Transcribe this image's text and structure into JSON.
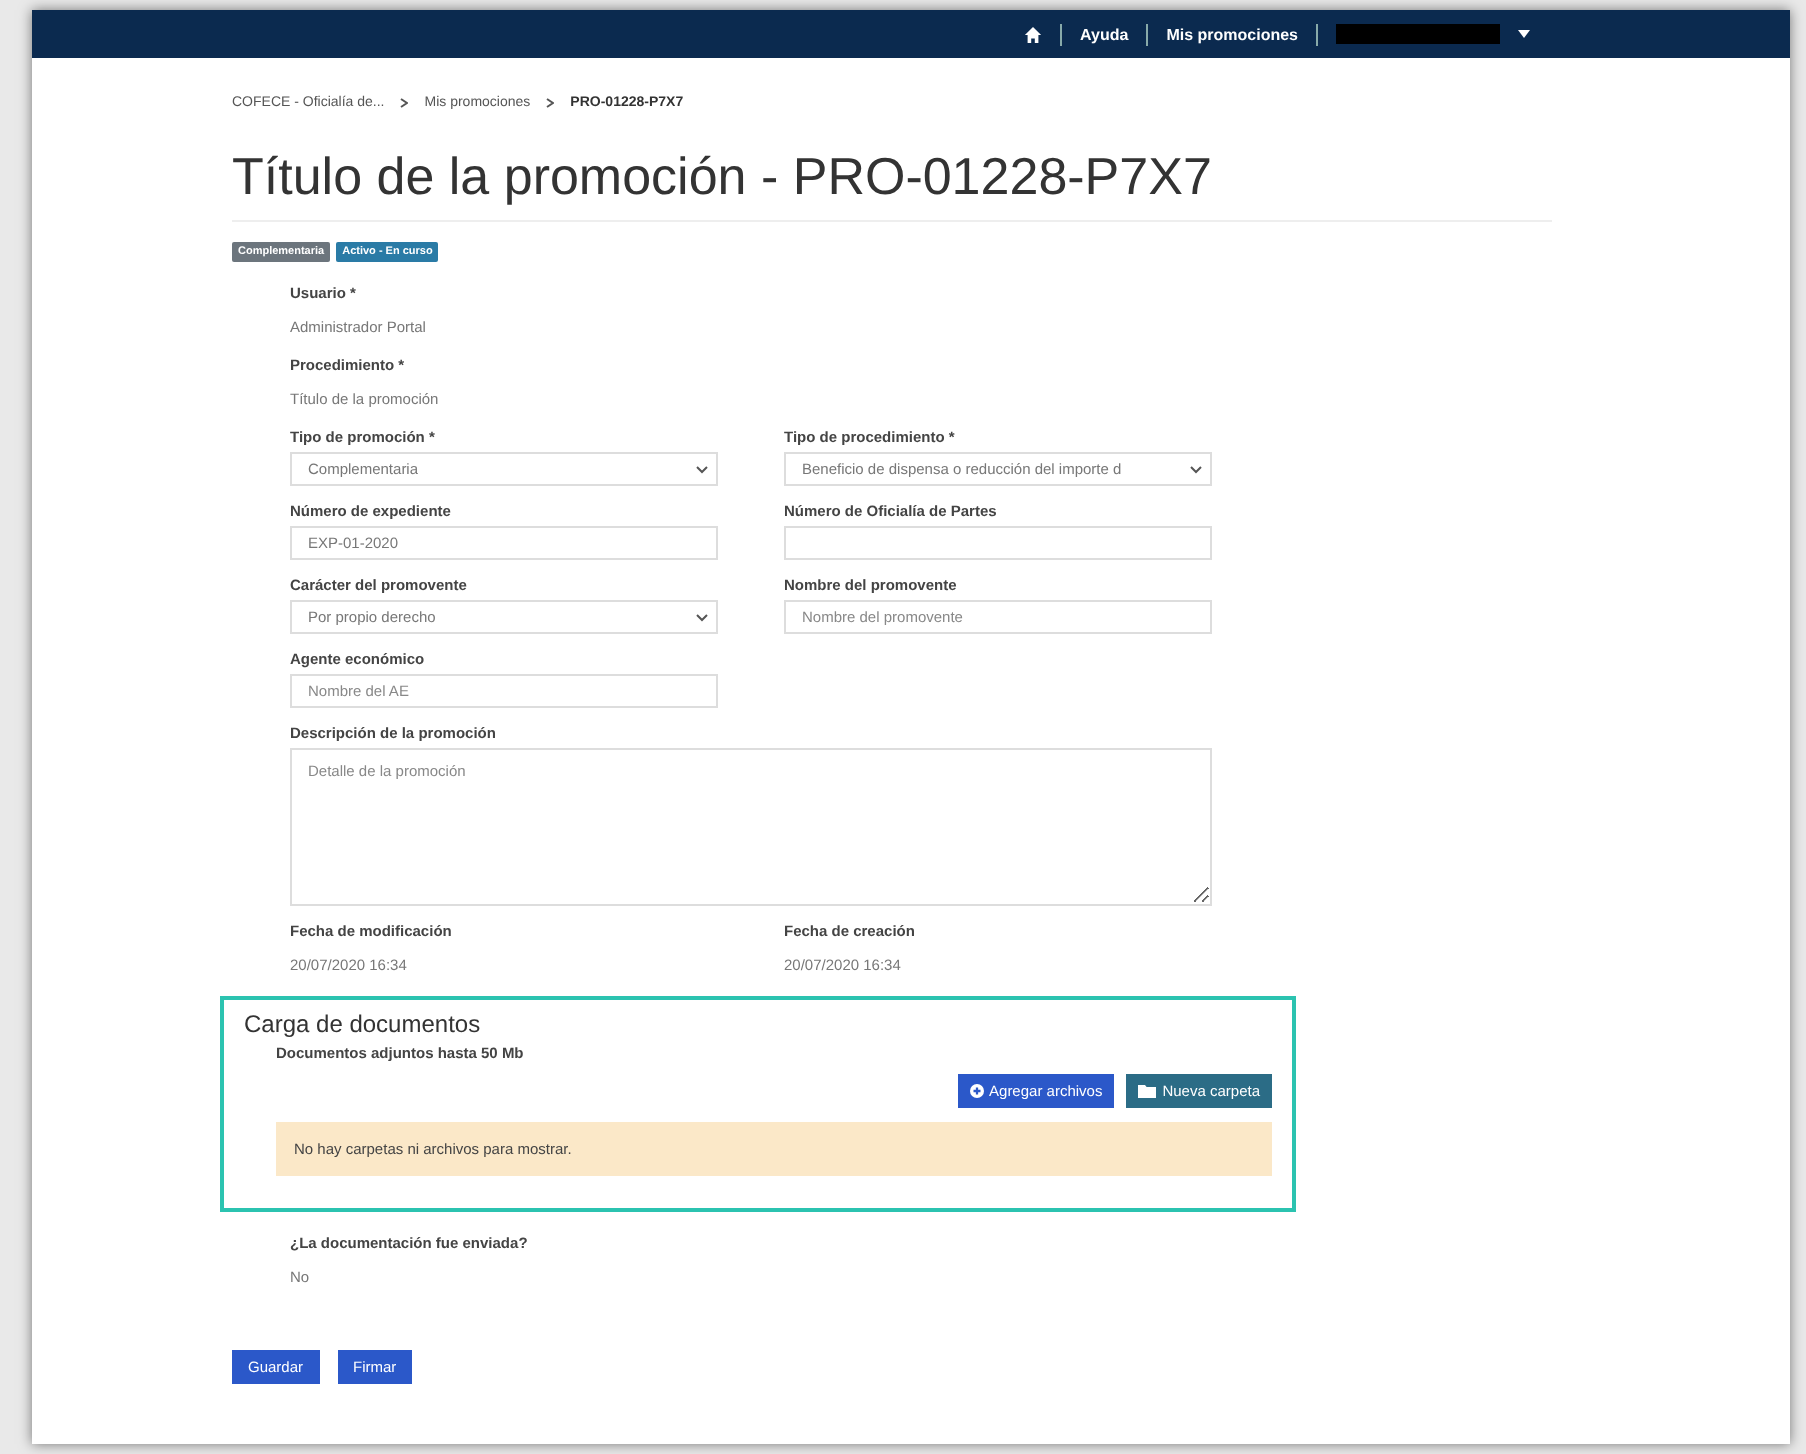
{
  "navbar": {
    "links": [
      "Ayuda",
      "Mis promociones"
    ]
  },
  "breadcrumb": [
    {
      "label": "COFECE - Oficialía de...",
      "selected": false
    },
    {
      "label": "Mis promociones",
      "selected": false
    },
    {
      "label": "PRO-01228-P7X7",
      "selected": true
    }
  ],
  "title": "Título de la promoción - PRO-01228-P7X7",
  "badges": [
    {
      "label": "Complementaria",
      "color": "#6c757d"
    },
    {
      "label": "Activo - En curso",
      "color": "#2a7ba6"
    }
  ],
  "form_rows": [
    [
      {
        "kind": "static",
        "label": "Usuario *",
        "value": "Administrador Portal"
      }
    ],
    [
      {
        "kind": "static",
        "label": "Procedimiento *",
        "value": "Título de la promoción"
      }
    ],
    [
      {
        "kind": "select",
        "label": "Tipo de promoción *",
        "value": "Complementaria"
      },
      {
        "kind": "select",
        "label": "Tipo de procedimiento *",
        "value": "Beneficio de dispensa o reducción del importe d"
      }
    ],
    [
      {
        "kind": "input",
        "label": "Número de expediente",
        "value": "EXP-01-2020"
      },
      {
        "kind": "input",
        "label": "Número de Oficialía de Partes"
      }
    ],
    [
      {
        "kind": "select",
        "label": "Carácter del promovente",
        "value": "Por propio derecho"
      },
      {
        "kind": "input",
        "label": "Nombre del promovente",
        "placeholder": "Nombre del promovente"
      }
    ],
    [
      {
        "kind": "input",
        "label": "Agente económico",
        "placeholder": "Nombre del AE"
      }
    ],
    [
      {
        "kind": "textarea",
        "label": "Descripción de la promoción",
        "placeholder": "Detalle de la promoción"
      }
    ],
    [
      {
        "kind": "static",
        "label": "Fecha de modificación",
        "value": "20/07/2020 16:34"
      },
      {
        "kind": "static",
        "label": "Fecha de creación",
        "value": "20/07/2020 16:34"
      }
    ]
  ],
  "documents": {
    "title": "Carga de documentos",
    "subtitle": "Documentos adjuntos hasta 50 Mb",
    "buttons": [
      {
        "kind": "add",
        "label": "Agregar archivos"
      },
      {
        "kind": "folder",
        "label": "Nueva carpeta"
      }
    ],
    "empty_message": "No hay carpetas ni archivos para mostrar."
  },
  "sent": {
    "label": "¿La documentación fue enviada?",
    "value": "No"
  },
  "actions": [
    "Guardar",
    "Firmar"
  ]
}
